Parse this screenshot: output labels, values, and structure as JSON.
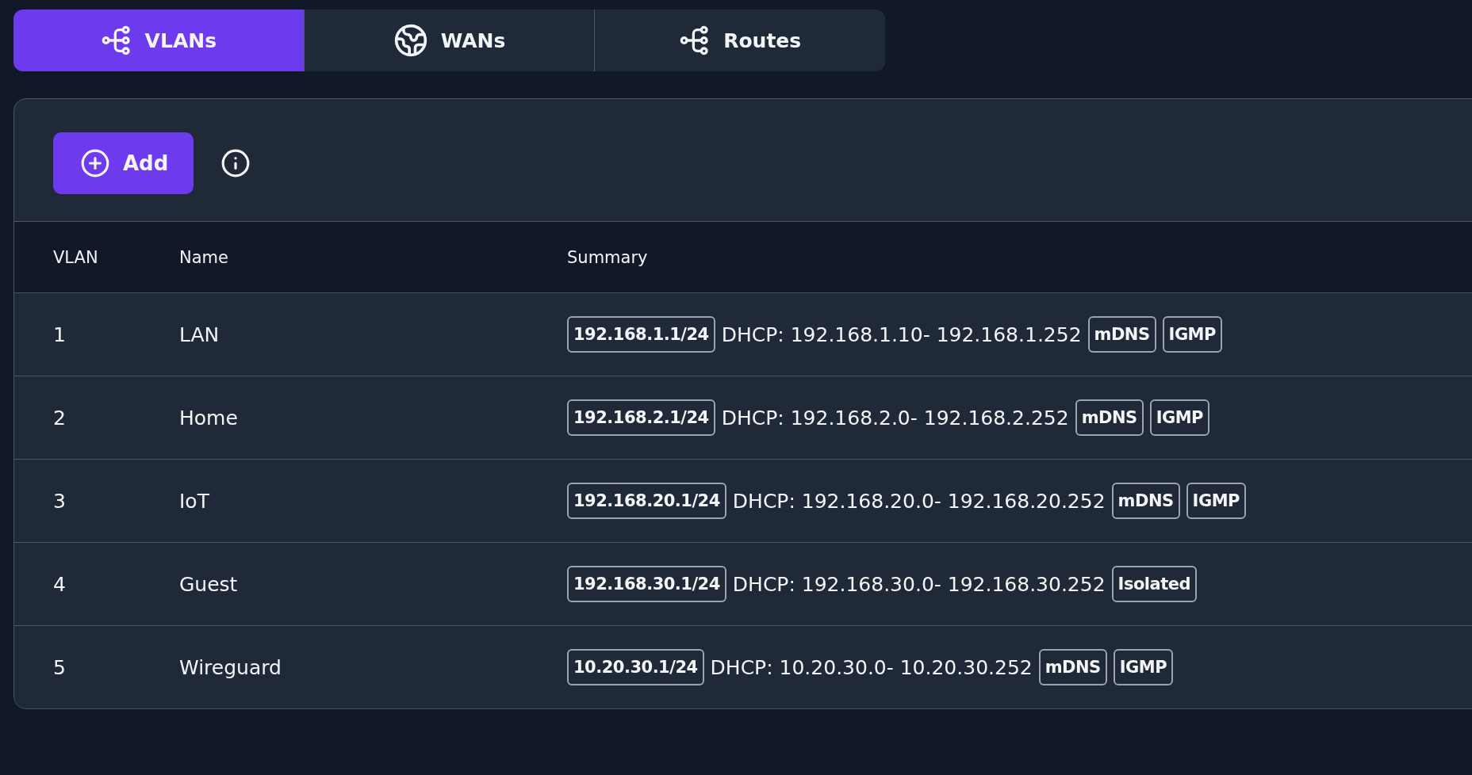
{
  "tabs": [
    {
      "label": "VLANs",
      "kind": "network",
      "selected": true
    },
    {
      "label": "WANs",
      "kind": "globe",
      "selected": false
    },
    {
      "label": "Routes",
      "kind": "network",
      "selected": false
    }
  ],
  "toolbar": {
    "add_button": "Add"
  },
  "table": {
    "columns": [
      "VLAN",
      "Name",
      "Summary"
    ],
    "rows": [
      {
        "vlan": "1",
        "name": "LAN",
        "subnet": "192.168.1.1/24",
        "dhcp": "DHCP: 192.168.1.10- 192.168.1.252",
        "tags": [
          "mDNS",
          "IGMP"
        ]
      },
      {
        "vlan": "2",
        "name": "Home",
        "subnet": "192.168.2.1/24",
        "dhcp": "DHCP: 192.168.2.0- 192.168.2.252",
        "tags": [
          "mDNS",
          "IGMP"
        ]
      },
      {
        "vlan": "3",
        "name": "IoT",
        "subnet": "192.168.20.1/24",
        "dhcp": "DHCP: 192.168.20.0- 192.168.20.252",
        "tags": [
          "mDNS",
          "IGMP"
        ]
      },
      {
        "vlan": "4",
        "name": "Guest",
        "subnet": "192.168.30.1/24",
        "dhcp": "DHCP: 192.168.30.0- 192.168.30.252",
        "tags": [
          "Isolated"
        ]
      },
      {
        "vlan": "5",
        "name": "Wireguard",
        "subnet": "10.20.30.1/24",
        "dhcp": "DHCP: 10.20.30.0- 10.20.30.252",
        "tags": [
          "mDNS",
          "IGMP"
        ]
      }
    ]
  }
}
